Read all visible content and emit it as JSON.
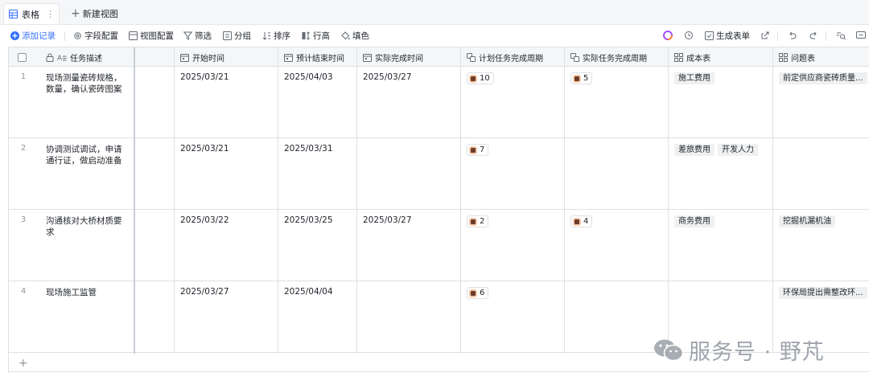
{
  "tabs": {
    "active": "表格",
    "new_view": "新建视图"
  },
  "toolbar": {
    "add_record": "添加记录",
    "field_config": "字段配置",
    "view_config": "视图配置",
    "filter": "筛选",
    "group": "分组",
    "sort": "排序",
    "row_height": "行高",
    "fill_color": "填色",
    "generate_form": "生成表单"
  },
  "columns": {
    "desc": "任务描述",
    "start": "开始时间",
    "planned_end": "预计结束时间",
    "actual_done": "实际完成时间",
    "planned_cycle": "计划任务完成周期",
    "actual_cycle": "实际任务完成周期",
    "cost": "成本表",
    "issues": "问题表"
  },
  "rows": [
    {
      "num": "1",
      "desc": "现场测量瓷砖规格，数量，确认瓷砖图案",
      "start": "2025/03/21",
      "planned_end": "2025/04/03",
      "actual_done": "2025/03/27",
      "planned_cycle": "10",
      "actual_cycle": "5",
      "cost": [
        "施工费用"
      ],
      "issues": [
        "前定供应商瓷砖质量..."
      ]
    },
    {
      "num": "2",
      "desc": "协调测试调试，申请通行证，做启动准备",
      "start": "2025/03/21",
      "planned_end": "2025/03/31",
      "actual_done": "",
      "planned_cycle": "7",
      "actual_cycle": "",
      "cost": [
        "差旅费用",
        "开发人力"
      ],
      "issues": []
    },
    {
      "num": "3",
      "desc": "沟通核对大桥材质要求",
      "start": "2025/03/22",
      "planned_end": "2025/03/25",
      "actual_done": "2025/03/27",
      "planned_cycle": "2",
      "actual_cycle": "4",
      "cost": [
        "商务费用"
      ],
      "issues": [
        "挖掘机漏机油"
      ]
    },
    {
      "num": "4",
      "desc": "现场施工监管",
      "start": "2025/03/27",
      "planned_end": "2025/04/04",
      "actual_done": "",
      "planned_cycle": "6",
      "actual_cycle": "",
      "cost": [],
      "issues": [
        "环保局提出需整改环..."
      ]
    }
  ],
  "watermark": "服务号 · 野芃"
}
